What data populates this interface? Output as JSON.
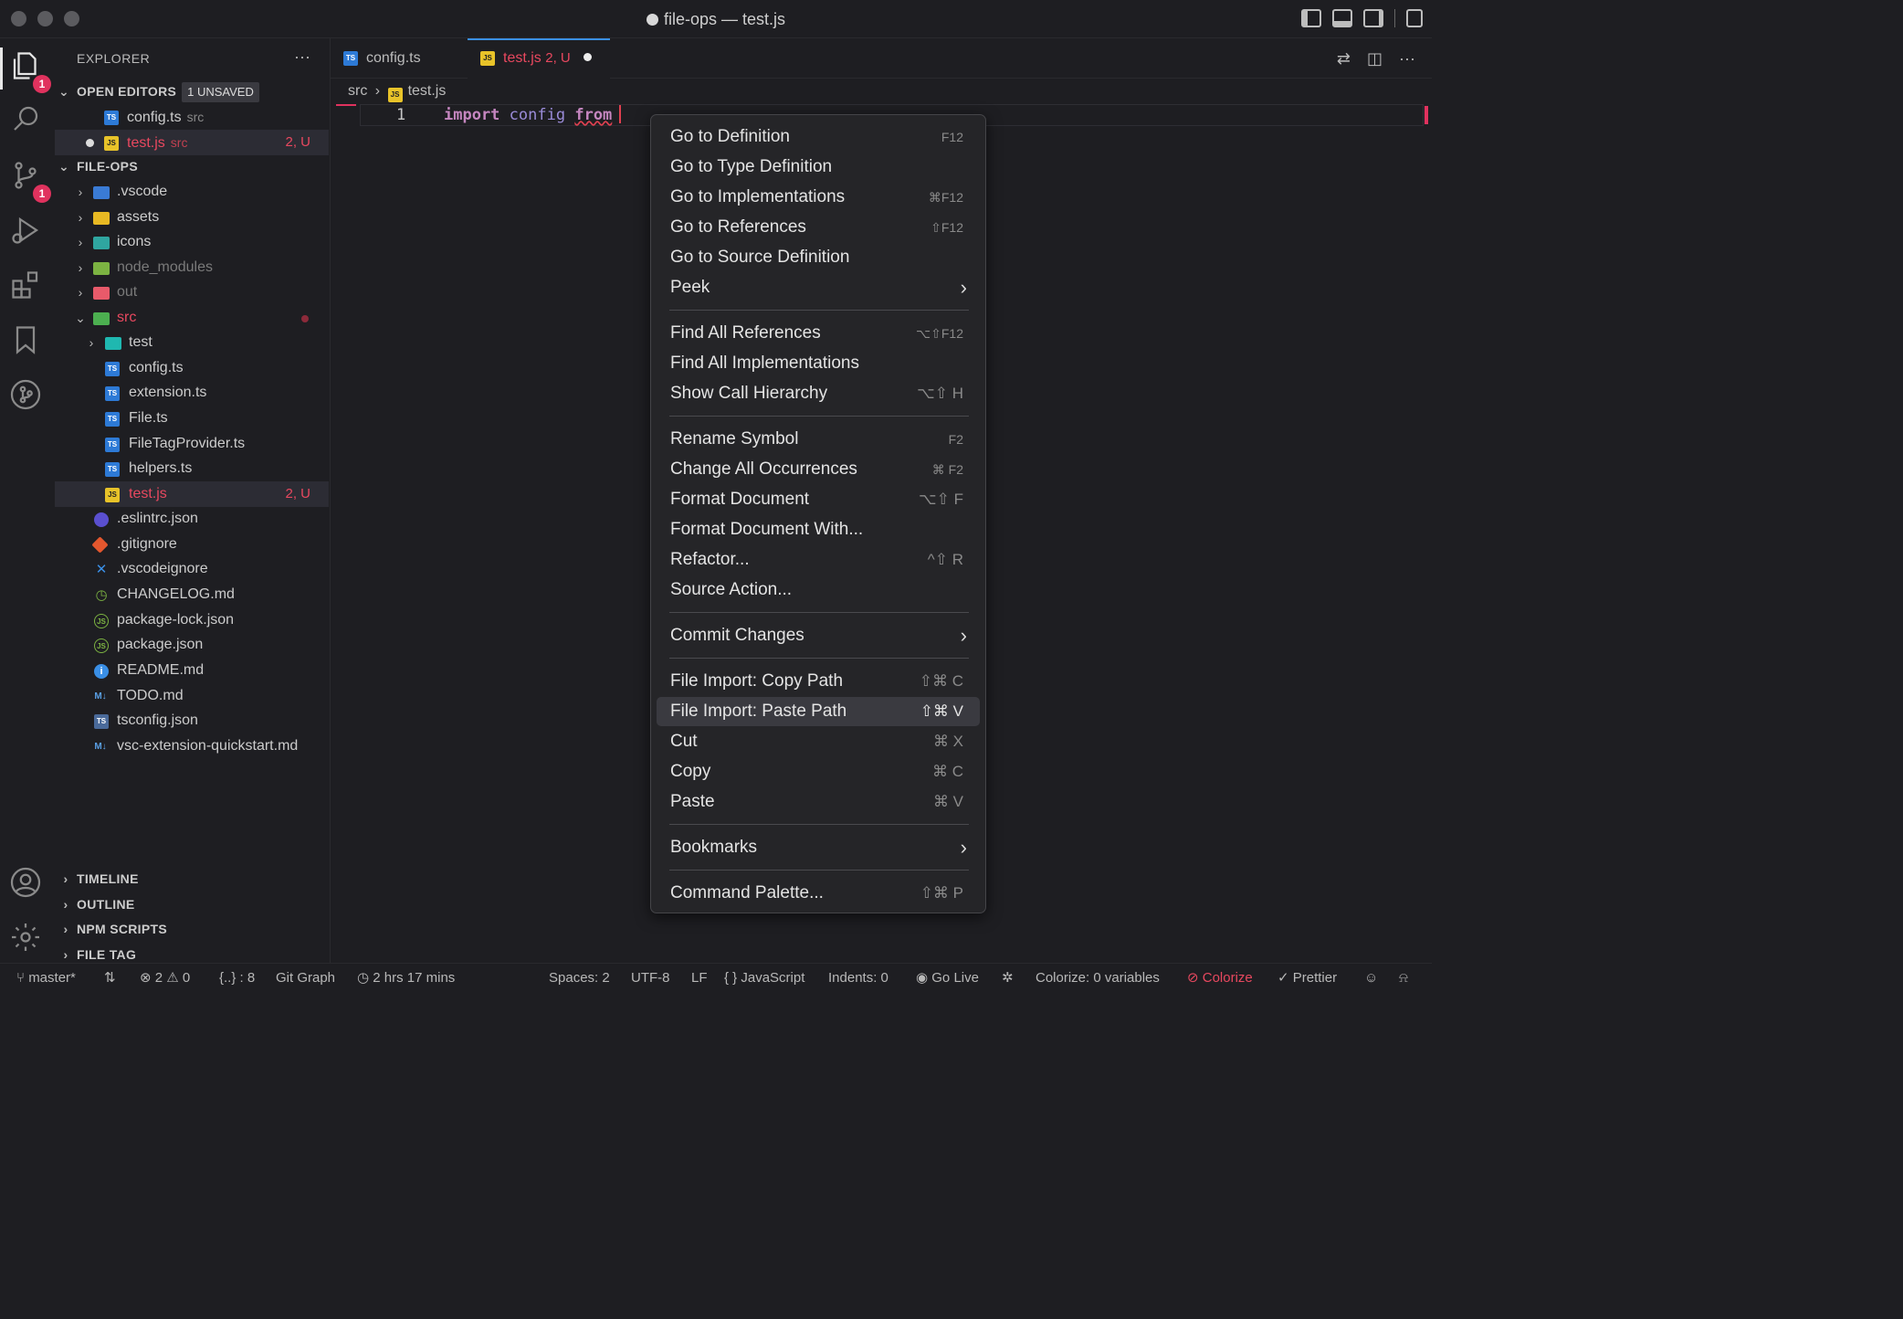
{
  "window": {
    "title": "file-ops — test.js"
  },
  "activity": {
    "explorer_badge": "1",
    "scm_badge": "1"
  },
  "sidebar": {
    "header": "EXPLORER",
    "more": "···",
    "open_editors": {
      "label": "OPEN EDITORS",
      "unsaved": "1 UNSAVED",
      "items": [
        {
          "name": "config.ts",
          "desc": "src"
        },
        {
          "name": "test.js",
          "desc": "src",
          "badge": "2, U"
        }
      ]
    },
    "folder": {
      "label": "FILE-OPS",
      "items": {
        "vscode": ".vscode",
        "assets": "assets",
        "icons": "icons",
        "node_modules": "node_modules",
        "out": "out",
        "src": "src",
        "test": "test",
        "config": "config.ts",
        "extension": "extension.ts",
        "file": "File.ts",
        "filetag": "FileTagProvider.ts",
        "helpers": "helpers.ts",
        "testjs": "test.js",
        "testjs_badge": "2, U",
        "eslint": ".eslintrc.json",
        "gitignore": ".gitignore",
        "vscodeignore": ".vscodeignore",
        "changelog": "CHANGELOG.md",
        "packagelock": "package-lock.json",
        "package": "package.json",
        "readme": "README.md",
        "todo": "TODO.md",
        "tsconfig": "tsconfig.json",
        "quickstart": "vsc-extension-quickstart.md"
      }
    },
    "sections": [
      "TIMELINE",
      "OUTLINE",
      "NPM SCRIPTS",
      "FILE TAG"
    ]
  },
  "tabs": [
    {
      "name": "config.ts"
    },
    {
      "name": "test.js",
      "badge": "2, U"
    }
  ],
  "breadcrumb": {
    "folder": "src",
    "file": "test.js"
  },
  "editor": {
    "line_number": "1",
    "kw_import": "import",
    "ident": "config",
    "kw_from": "from"
  },
  "context_menu": {
    "items": [
      {
        "label": "Go to Definition",
        "shortcut": "F12"
      },
      {
        "label": "Go to Type Definition",
        "shortcut": ""
      },
      {
        "label": "Go to Implementations",
        "shortcut": "⌘F12"
      },
      {
        "label": "Go to References",
        "shortcut": "⇧F12"
      },
      {
        "label": "Go to Source Definition",
        "shortcut": ""
      },
      {
        "label": "Peek",
        "shortcut": ""
      },
      {
        "label": "Find All References",
        "shortcut": "⌥⇧F12"
      },
      {
        "label": "Find All Implementations",
        "shortcut": ""
      },
      {
        "label": "Show Call Hierarchy",
        "shortcut": "⌥⇧ H"
      },
      {
        "label": "Rename Symbol",
        "shortcut": "F2"
      },
      {
        "label": "Change All Occurrences",
        "shortcut": "⌘ F2"
      },
      {
        "label": "Format Document",
        "shortcut": "⌥⇧ F"
      },
      {
        "label": "Format Document With...",
        "shortcut": ""
      },
      {
        "label": "Refactor...",
        "shortcut": "^⇧ R"
      },
      {
        "label": "Source Action...",
        "shortcut": ""
      },
      {
        "label": "Commit Changes",
        "shortcut": ""
      },
      {
        "label": "File Import: Copy Path",
        "shortcut": "⇧⌘ C"
      },
      {
        "label": "File Import: Paste Path",
        "shortcut": "⇧⌘ V"
      },
      {
        "label": "Cut",
        "shortcut": "⌘ X"
      },
      {
        "label": "Copy",
        "shortcut": "⌘ C"
      },
      {
        "label": "Paste",
        "shortcut": "⌘ V"
      },
      {
        "label": "Bookmarks",
        "shortcut": ""
      },
      {
        "label": "Command Palette...",
        "shortcut": "⇧⌘ P"
      }
    ]
  },
  "statusbar": {
    "branch": "master*",
    "problems": "⊗ 2 ⚠ 0",
    "braces": "{..} : 8",
    "git_graph": "Git Graph",
    "time": "2 hrs 17 mins",
    "spaces": "Spaces: 2",
    "encoding": "UTF-8",
    "eol": "LF",
    "language": "JavaScript",
    "indents": "Indents: 0",
    "golive": "Go Live",
    "colorize_vars": "Colorize: 0 variables",
    "colorize": "Colorize",
    "prettier": "Prettier"
  },
  "colors": {
    "accent": "#3a8fe6",
    "error": "#e8485f",
    "badge": "#e0325e"
  }
}
